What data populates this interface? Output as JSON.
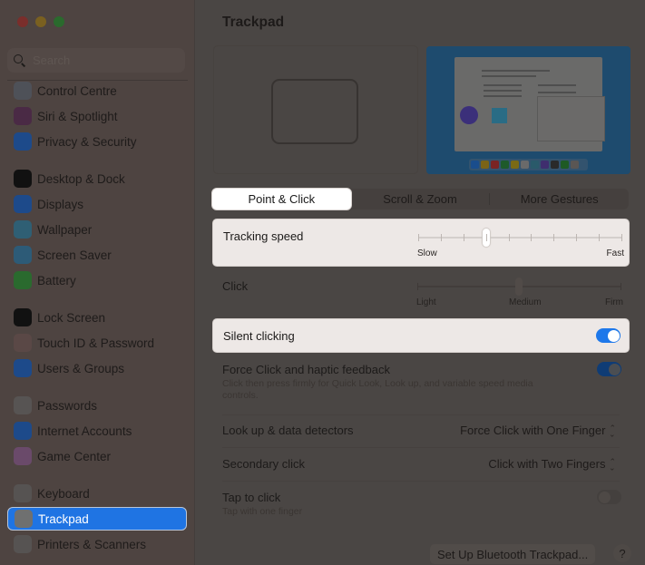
{
  "window": {
    "title": "Trackpad"
  },
  "sidebar": {
    "search_placeholder": "Search",
    "search_value": "",
    "selected": "Trackpad",
    "items": [
      {
        "label": "Control Centre",
        "icon": "control-centre-icon",
        "color": "#4e5158"
      },
      {
        "label": "Siri & Spotlight",
        "icon": "siri-icon",
        "color": "#4a2a45"
      },
      {
        "label": "Privacy & Security",
        "icon": "hand-icon",
        "color": "#1d4a8a"
      },
      {
        "label": "Desktop & Dock",
        "icon": "dock-icon",
        "color": "#111111"
      },
      {
        "label": "Displays",
        "icon": "sun-icon",
        "color": "#1d4a8a"
      },
      {
        "label": "Wallpaper",
        "icon": "flower-icon",
        "color": "#2f5f74"
      },
      {
        "label": "Screen Saver",
        "icon": "screen-saver-icon",
        "color": "#2d5b77"
      },
      {
        "label": "Battery",
        "icon": "battery-icon",
        "color": "#2a6a2e"
      },
      {
        "label": "Lock Screen",
        "icon": "lock-icon",
        "color": "#111111"
      },
      {
        "label": "Touch ID & Password",
        "icon": "fingerprint-icon",
        "color": "#5a4846"
      },
      {
        "label": "Users & Groups",
        "icon": "users-icon",
        "color": "#1d4a8a"
      },
      {
        "label": "Passwords",
        "icon": "key-icon",
        "color": "#575453"
      },
      {
        "label": "Internet Accounts",
        "icon": "at-icon",
        "color": "#1d4a8a"
      },
      {
        "label": "Game Center",
        "icon": "game-center-icon",
        "color": "#6a4a6a"
      },
      {
        "label": "Keyboard",
        "icon": "keyboard-icon",
        "color": "#565352"
      },
      {
        "label": "Trackpad",
        "icon": "trackpad-icon",
        "color": "#6f7070"
      },
      {
        "label": "Printers & Scanners",
        "icon": "printer-icon",
        "color": "#565352"
      }
    ]
  },
  "tabs": [
    {
      "label": "Point & Click",
      "active": true
    },
    {
      "label": "Scroll & Zoom",
      "active": false
    },
    {
      "label": "More Gestures",
      "active": false
    }
  ],
  "settings": {
    "tracking_speed": {
      "label": "Tracking speed",
      "min_label": "Slow",
      "max_label": "Fast",
      "steps": 10,
      "value_fraction": 0.333
    },
    "click": {
      "label": "Click",
      "labels": [
        "Light",
        "Medium",
        "Firm"
      ],
      "value_fraction": 0.5
    },
    "silent_clicking": {
      "label": "Silent clicking",
      "on": true
    },
    "force_click": {
      "label": "Force Click and haptic feedback",
      "description": "Click then press firmly for Quick Look, Look up, and variable speed media controls.",
      "on": true
    },
    "look_up": {
      "label": "Look up & data detectors",
      "value": "Force Click with One Finger"
    },
    "secondary_click": {
      "label": "Secondary click",
      "value": "Click with Two Fingers"
    },
    "tap_to_click": {
      "label": "Tap to click",
      "description": "Tap with one finger",
      "on": false
    }
  },
  "footer": {
    "bluetooth_button": "Set Up Bluetooth Trackpad...",
    "help_button": "?"
  },
  "preview": {
    "dock_colors": [
      "#1a4d8c",
      "#7a6316",
      "#7a2424",
      "#1e5a2a",
      "#7a6a16",
      "#6a6a6a",
      "#2a5a6a",
      "#3f2e6e",
      "#2a2a2a",
      "#1e5a24",
      "#5a5654"
    ]
  },
  "colors": {
    "accent": "#1e78ea",
    "selected_sidebar": "#1f74e3"
  }
}
